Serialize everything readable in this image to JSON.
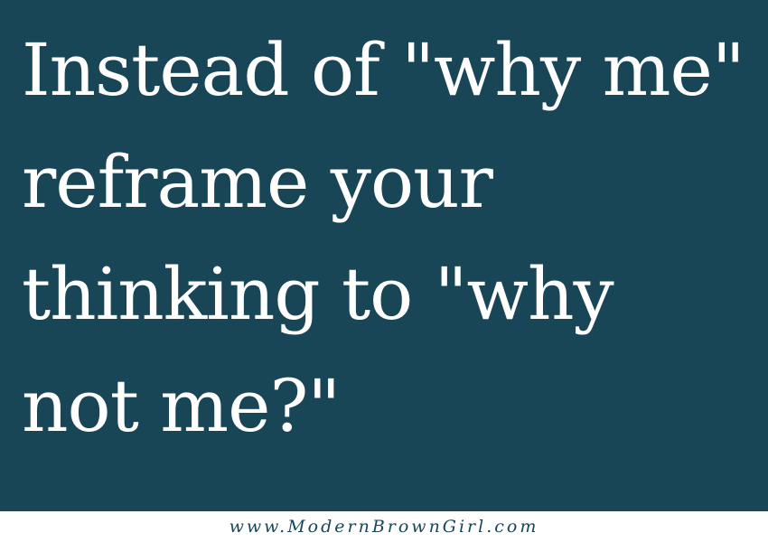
{
  "quote": {
    "lines": [
      "Instead of \"why me\"",
      "reframe your",
      "thinking to \"why",
      "not me?\""
    ]
  },
  "footer": {
    "url": "www.ModernBrownGirl.com"
  },
  "colors": {
    "panel_background": "#184656",
    "quote_text": "#ffffff",
    "footer_background": "#ffffff",
    "footer_text": "#184656"
  }
}
